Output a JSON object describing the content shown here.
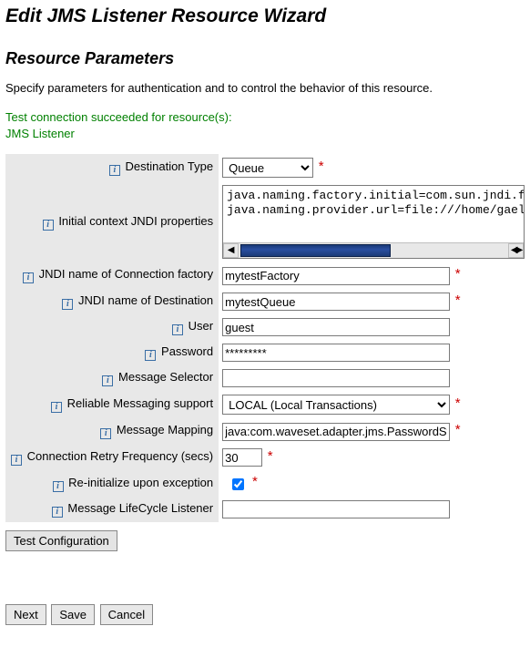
{
  "title": "Edit JMS Listener Resource Wizard",
  "section_heading": "Resource Parameters",
  "description": "Specify parameters for authentication and to control the behavior of this resource.",
  "success": {
    "line1": "Test connection succeeded for resource(s):",
    "line2": "JMS Listener"
  },
  "labels": {
    "destination_type": "Destination Type",
    "jndi_props": "Initial context JNDI properties",
    "conn_factory": "JNDI name of Connection factory",
    "destination_name": "JNDI name of Destination",
    "user": "User",
    "password": "Password",
    "message_selector": "Message Selector",
    "reliable": "Reliable Messaging support",
    "message_mapping": "Message Mapping",
    "retry_freq": "Connection Retry Frequency (secs)",
    "reinit": "Re-initialize upon exception",
    "lifecycle": "Message LifeCycle Listener"
  },
  "values": {
    "destination_type": "Queue",
    "jndi_props": "java.naming.factory.initial=com.sun.jndi.f\njava.naming.provider.url=file:///home/gael",
    "conn_factory": "mytestFactory",
    "destination_name": "mytestQueue",
    "user": "guest",
    "password": "*********",
    "message_selector": "",
    "reliable": "LOCAL (Local Transactions)",
    "message_mapping": "java:com.waveset.adapter.jms.PasswordSync",
    "retry_freq": "30",
    "reinit": true,
    "lifecycle": ""
  },
  "buttons": {
    "test_config": "Test Configuration",
    "next": "Next",
    "save": "Save",
    "cancel": "Cancel"
  }
}
